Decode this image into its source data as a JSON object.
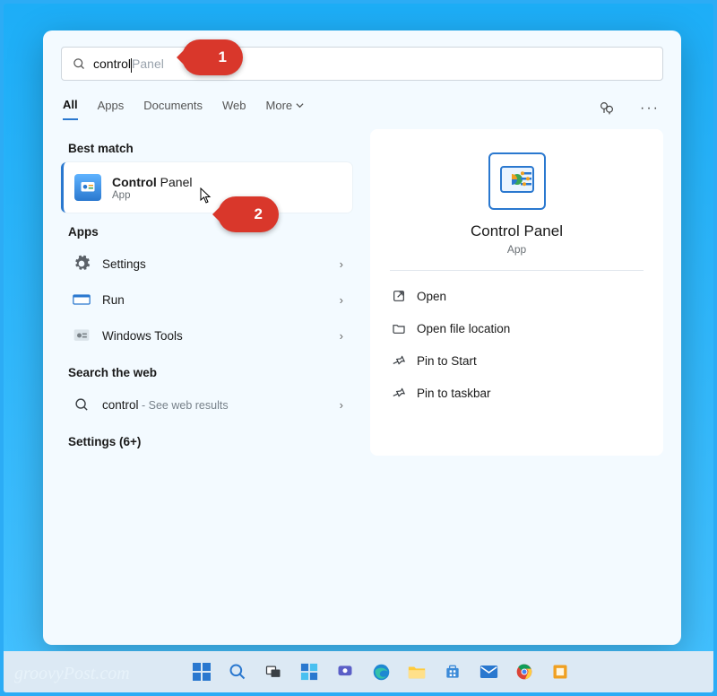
{
  "search": {
    "typed": "control",
    "suggestion": "Panel"
  },
  "tabs": {
    "all": "All",
    "apps": "Apps",
    "documents": "Documents",
    "web": "Web",
    "more": "More"
  },
  "sections": {
    "best_match": "Best match",
    "apps": "Apps",
    "web": "Search the web",
    "settings": "Settings (6+)"
  },
  "best_match": {
    "title_bold": "Control",
    "title_rest": " Panel",
    "subtitle": "App"
  },
  "apps": [
    {
      "label": "Settings",
      "icon": "gear-icon"
    },
    {
      "label": "Run",
      "icon": "run-icon"
    },
    {
      "label": "Windows Tools",
      "icon": "tools-icon"
    }
  ],
  "web_result": {
    "query": "control",
    "suffix": " - See web results"
  },
  "preview": {
    "title": "Control Panel",
    "subtitle": "App",
    "actions": {
      "open": "Open",
      "file_location": "Open file location",
      "pin_start": "Pin to Start",
      "pin_taskbar": "Pin to taskbar"
    }
  },
  "callouts": {
    "one": "1",
    "two": "2"
  },
  "watermark": "groovyPost.com"
}
